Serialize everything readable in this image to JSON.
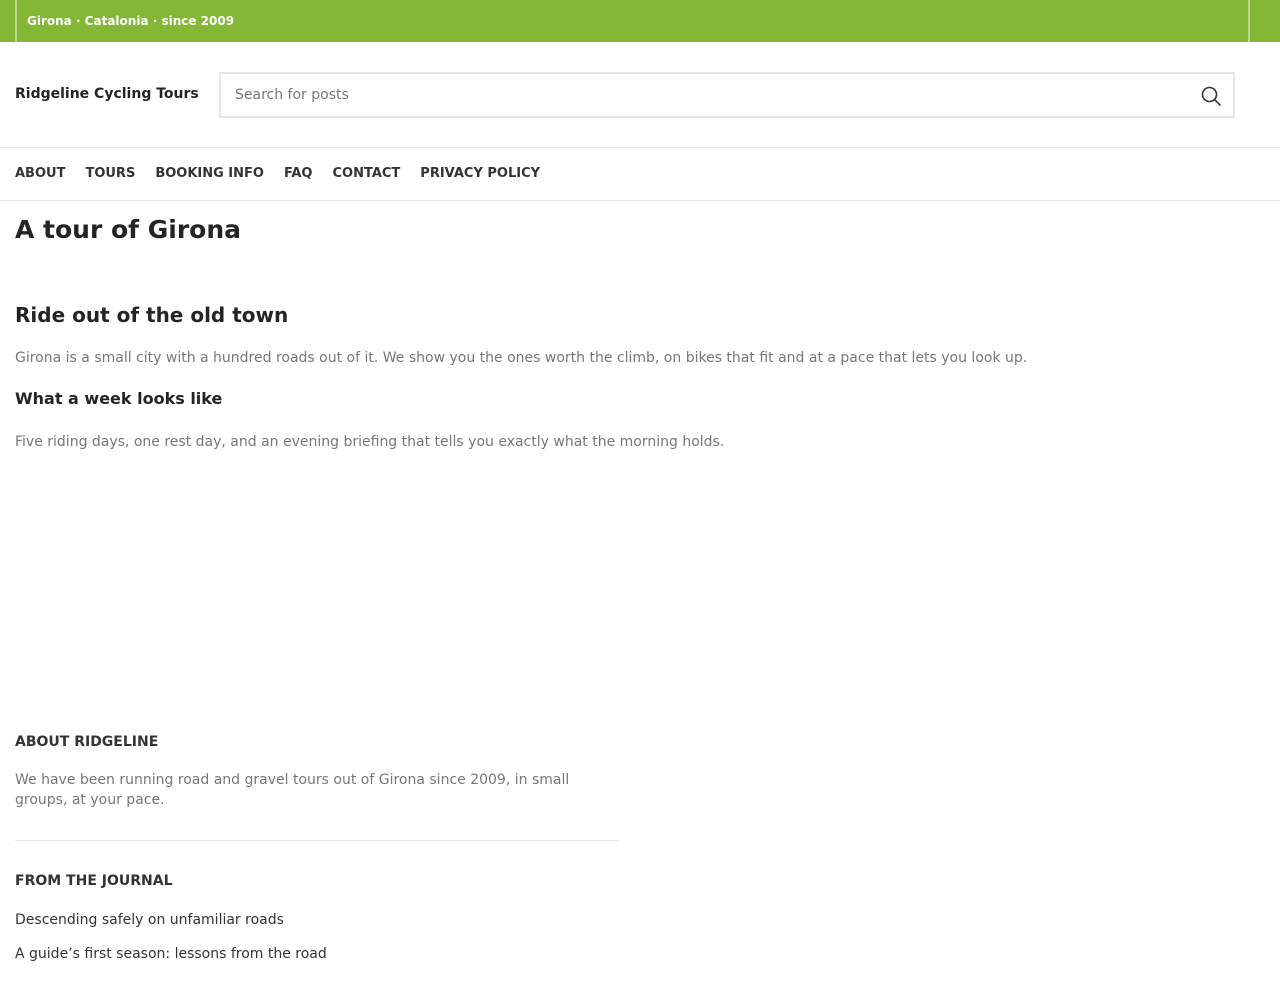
{
  "topbar": {
    "tagline": "Girona · Catalonia · since 2009",
    "background_color": "#83b735"
  },
  "header": {
    "site_title": "Ridgeline Cycling Tours",
    "search": {
      "placeholder": "Search for posts",
      "value": "",
      "icon": "search-icon"
    }
  },
  "nav": {
    "items": [
      {
        "label": "ABOUT"
      },
      {
        "label": "TOURS"
      },
      {
        "label": "BOOKING INFO"
      },
      {
        "label": "FAQ"
      },
      {
        "label": "CONTACT"
      },
      {
        "label": "PRIVACY POLICY"
      }
    ]
  },
  "main": {
    "page_title": "A tour of Girona",
    "sections": [
      {
        "heading": "Ride out of the old town",
        "body": "Girona is a small city with a hundred roads out of it. We show you the ones worth the climb, on bikes that fit and at a pace that lets you look up."
      },
      {
        "heading": "What a week looks like",
        "body": "Five riding days, one rest day, and an evening briefing that tells you exactly what the morning holds."
      }
    ]
  },
  "footer": {
    "about": {
      "title": "ABOUT RIDGELINE",
      "text": "We have been running road and gravel tours out of Girona since 2009, in small groups, at your pace."
    },
    "journal": {
      "title": "FROM THE JOURNAL",
      "links": [
        {
          "label": "Descending safely on unfamiliar roads"
        },
        {
          "label": "A guide’s first season: lessons from the road"
        }
      ]
    }
  }
}
